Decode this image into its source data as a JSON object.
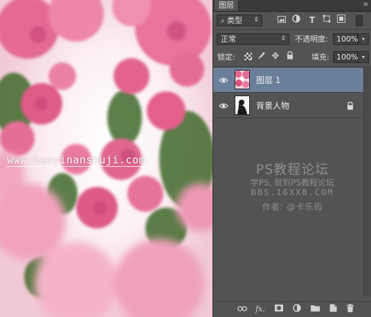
{
  "panel": {
    "tab": "图层",
    "menu_icon": "panel-menu-icon"
  },
  "filter": {
    "kind_label": "类型",
    "icons": [
      "image-filter-icon",
      "adjustment-filter-icon",
      "type-filter-icon",
      "shape-filter-icon",
      "smart-object-filter-icon"
    ]
  },
  "blend": {
    "mode": "正常",
    "opacity_label": "不透明度:",
    "opacity_value": "100%"
  },
  "lock": {
    "label": "锁定:",
    "fill_label": "填充:",
    "fill_value": "100%",
    "icons": [
      "lock-transparent-icon",
      "lock-pixels-icon",
      "lock-position-icon",
      "lock-all-icon"
    ]
  },
  "layers": [
    {
      "name": "图层 1",
      "selected": true,
      "locked": false
    },
    {
      "name": "背景人物",
      "selected": false,
      "locked": true
    }
  ],
  "watermark_text": {
    "line1": "PS教程论坛",
    "line2": "学PS, 就到PS教程论坛",
    "line3": "BBS.16XX8.COM",
    "line4": "作者: @卡乐筠"
  },
  "canvas_watermark": "www.haoyinanshuji.com",
  "footer_icons": [
    "link-layers-icon",
    "fx-icon",
    "add-mask-icon",
    "new-adjustment-icon",
    "new-group-icon",
    "new-layer-icon",
    "delete-layer-icon"
  ],
  "footer_fx_label": "fx.",
  "colors": {
    "panel_bg": "#535353",
    "selected_layer": "#6a7f99",
    "watermark_grey": "#8f8f8f"
  }
}
